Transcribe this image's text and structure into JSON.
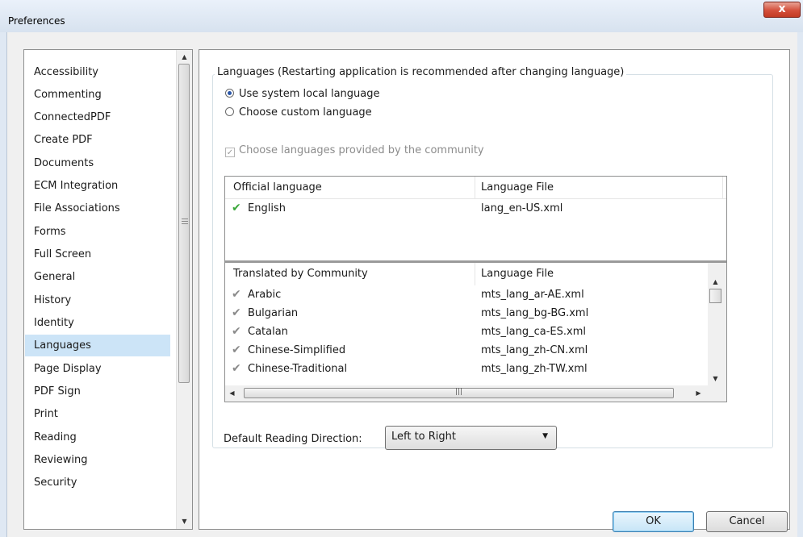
{
  "window": {
    "title": "Preferences",
    "close_label": "x"
  },
  "nav": {
    "items": [
      {
        "label": "Accessibility"
      },
      {
        "label": "Commenting"
      },
      {
        "label": "ConnectedPDF"
      },
      {
        "label": "Create PDF"
      },
      {
        "label": "Documents"
      },
      {
        "label": "ECM Integration"
      },
      {
        "label": "File Associations"
      },
      {
        "label": "Forms"
      },
      {
        "label": "Full Screen"
      },
      {
        "label": "General"
      },
      {
        "label": "History"
      },
      {
        "label": "Identity"
      },
      {
        "label": "Languages",
        "selected": true
      },
      {
        "label": "Page Display"
      },
      {
        "label": "PDF Sign"
      },
      {
        "label": "Print"
      },
      {
        "label": "Reading"
      },
      {
        "label": "Reviewing"
      },
      {
        "label": "Security"
      }
    ]
  },
  "languages": {
    "group_title": "Languages (Restarting application is recommended after changing language)",
    "radio_system": "Use system local language",
    "radio_custom": "Choose custom language",
    "community_checkbox": "Choose languages provided by the community",
    "official_table": {
      "col1": "Official language",
      "col2": "Language File",
      "rows": [
        {
          "language": "English",
          "file": "lang_en-US.xml"
        }
      ]
    },
    "community_table": {
      "col1": "Translated by Community",
      "col2": "Language File",
      "rows": [
        {
          "language": "Arabic",
          "file": "mts_lang_ar-AE.xml"
        },
        {
          "language": "Bulgarian",
          "file": "mts_lang_bg-BG.xml"
        },
        {
          "language": "Catalan",
          "file": "mts_lang_ca-ES.xml"
        },
        {
          "language": "Chinese-Simplified",
          "file": "mts_lang_zh-CN.xml"
        },
        {
          "language": "Chinese-Traditional",
          "file": "mts_lang_zh-TW.xml"
        }
      ]
    },
    "reading_direction_label": "Default Reading Direction:",
    "reading_direction_value": "Left to Right"
  },
  "buttons": {
    "ok": "OK",
    "cancel": "Cancel"
  },
  "colors": {
    "selected_bg": "#cce4f7",
    "check_green": "#3aa83a",
    "close_red": "#c23a22"
  }
}
